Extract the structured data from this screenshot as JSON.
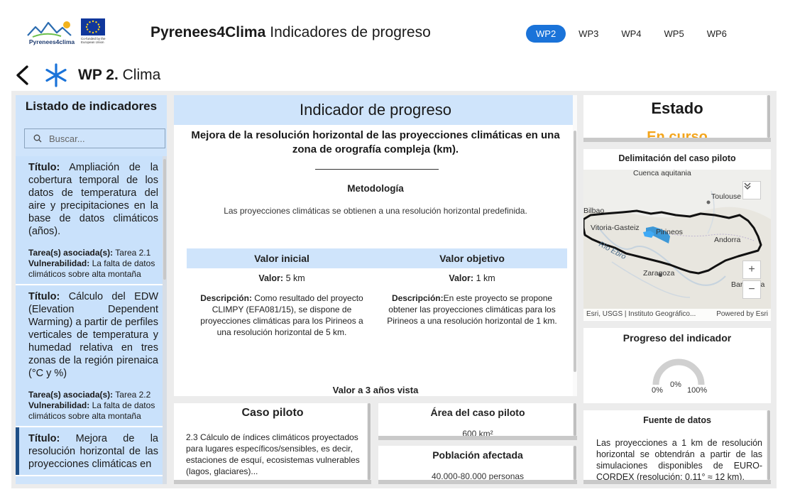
{
  "header": {
    "brand_name": "Pyrenees4Clima",
    "brand_subtitle": "Indicadores de progreso",
    "logo_text": "Pyrenees4clima",
    "eu_logo_text": "Co-funded by the European Union",
    "tabs": [
      {
        "label": "WP2",
        "active": true
      },
      {
        "label": "WP3",
        "active": false
      },
      {
        "label": "WP4",
        "active": false
      },
      {
        "label": "WP5",
        "active": false
      },
      {
        "label": "WP6",
        "active": false
      }
    ]
  },
  "workpackage": {
    "code": "WP 2.",
    "name": "Clima",
    "icon": "snowflake-icon"
  },
  "sidebar": {
    "title": "Listado de indicadores",
    "search_placeholder": "Buscar...",
    "items": [
      {
        "title_label": "Título:",
        "title": "Ampliación de la cobertura temporal de los datos de temperatura del aire y precipitaciones en la base de datos climáticos (años).",
        "task_label": "Tarea(s) asociada(s):",
        "task": "Tarea 2.1",
        "vuln_label": "Vulnerabilidad:",
        "vuln": "La falta de datos climáticos sobre alta montaña"
      },
      {
        "title_label": "Título:",
        "title": "Cálculo del EDW (Elevation Dependent Warming) a partir de perfiles verticales de temperatura y humedad relativa en tres zonas de la región pirenaica (°C y %)",
        "task_label": "Tarea(s) asociada(s):",
        "task": "Tarea 2.2",
        "vuln_label": "Vulnerabilidad:",
        "vuln": "La falta de datos climáticos sobre alta montaña"
      },
      {
        "title_label": "Título:",
        "title": "Mejora de la resolución horizontal de las proyecciones climáticas en"
      }
    ]
  },
  "indicator": {
    "header": "Indicador de progreso",
    "title": "Mejora de la resolución horizontal de las proyecciones climáticas en una zona de orografía compleja (km).",
    "methodology_label": "Metodología",
    "methodology": "Las proyecciones climáticas se obtienen a una resolución horizontal predefinida.",
    "initial_header": "Valor inicial",
    "target_header": "Valor objetivo",
    "value_label": "Valor:",
    "initial_value": "5 km",
    "target_value": "1 km",
    "desc_label": "Descripción:",
    "initial_desc": "Como resultado del proyecto CLIMPY (EFA081/15), se dispone de proyecciones climáticas para los Pirineos a una resolución horizontal de 5 km.",
    "target_desc": "En este proyecto se propone obtener las proyecciones climáticas para los Pirineos a una resolución horizontal de 1 km.",
    "three_year": "Valor a 3 años vista"
  },
  "pilot": {
    "title": "Caso piloto",
    "text": "2.3 Cálculo de índices climáticos proyectados para lugares específicos/sensibles, es decir, estaciones de esquí, ecosistemas vulnerables (lagos, glaciares)...",
    "area_title": "Área del caso piloto",
    "area_value": "600 km²",
    "population_title": "Población afectada",
    "population_value": "40.000-80.000 personas"
  },
  "status": {
    "title": "Estado",
    "value": "En curso",
    "color": "#f4a51c"
  },
  "map": {
    "title": "Delimitación del caso piloto",
    "labels": [
      "Cuenca aquitania",
      "Toulouse",
      "Bilbao",
      "Vitoria-Gasteiz",
      "Pirineos",
      "Andorra",
      "Río Ebro",
      "Zaragoza",
      "Barcelona"
    ],
    "attribution": "Esri, USGS | Instituto Geográfico...",
    "powered": "Powered by Esri",
    "zoom_in": "+",
    "zoom_out": "−"
  },
  "progress": {
    "title": "Progreso del indicador",
    "min": "0%",
    "value": "0%",
    "max": "100%",
    "fraction": 0
  },
  "source": {
    "title": "Fuente de datos",
    "text": "Las proyecciones a 1 km de resolución horizontal se obtendrán a partir de las simulaciones disponibles de EURO-CORDEX (resolución: 0.11° ≈ 12 km)."
  }
}
